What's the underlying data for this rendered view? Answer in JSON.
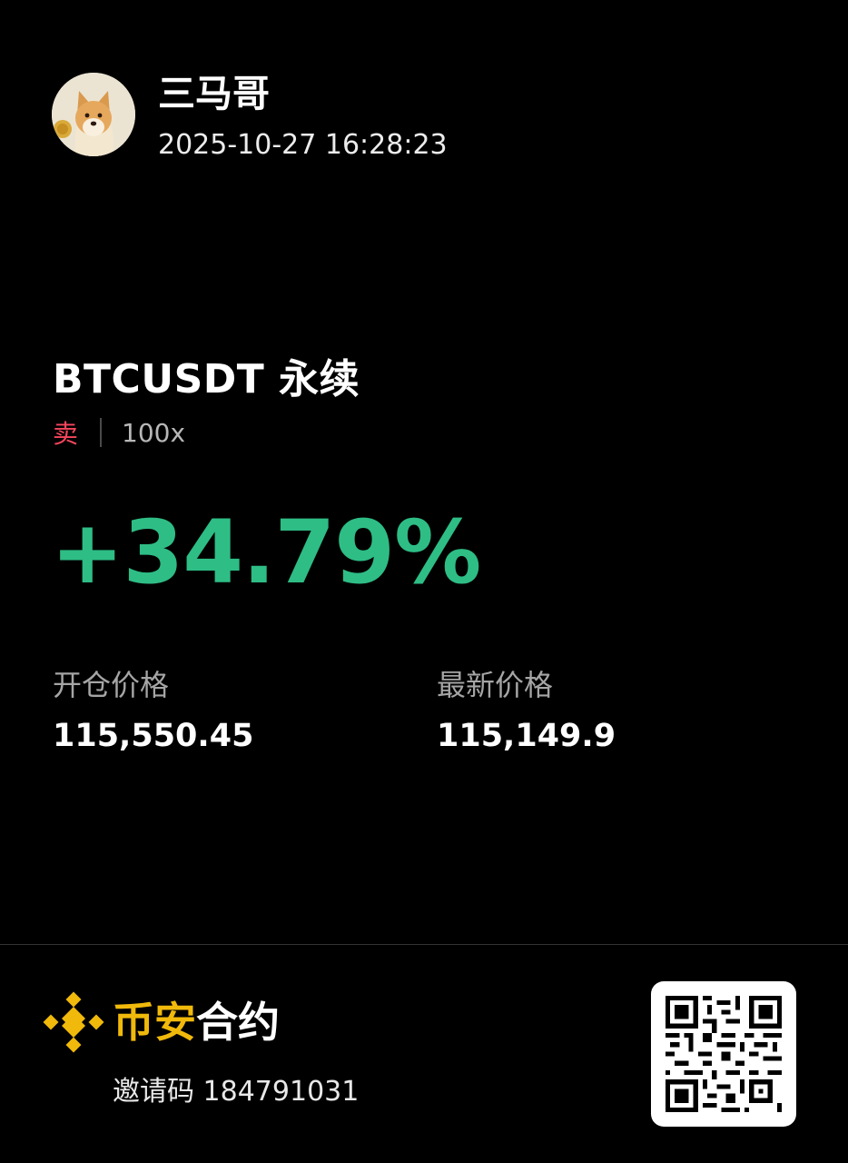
{
  "user": {
    "name": "三马哥",
    "timestamp": "2025-10-27 16:28:23"
  },
  "position": {
    "symbol": "BTCUSDT 永续",
    "side": "卖",
    "leverage": "100x",
    "pnl_percent": "+34.79%"
  },
  "prices": {
    "entry_label": "开仓价格",
    "entry_value": "115,550.45",
    "last_label": "最新价格",
    "last_value": "115,149.9"
  },
  "footer": {
    "brand_part1": "币安",
    "brand_part2": "合约",
    "invite_label": "邀请码",
    "invite_code": "184791031"
  },
  "icons": {
    "avatar": "shiba-dog-avatar",
    "logo": "binance-logo-icon",
    "qr": "qr-code-icon"
  },
  "colors": {
    "background": "#000000",
    "sell": "#f6465d",
    "profit": "#2ebd85",
    "brand": "#f0b90b"
  }
}
